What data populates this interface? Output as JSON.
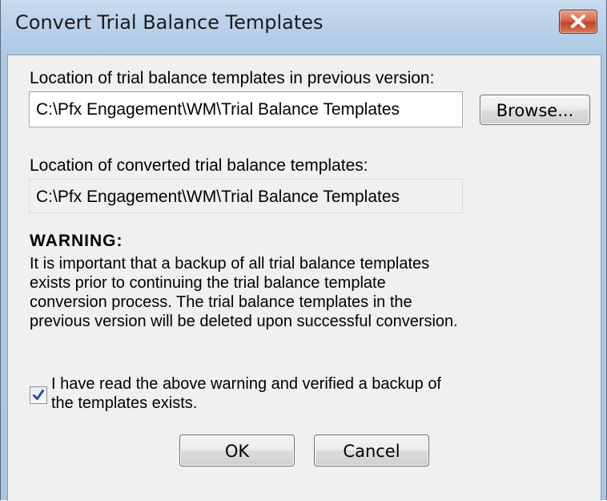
{
  "window": {
    "title": "Convert Trial Balance Templates"
  },
  "source": {
    "label": "Location of trial balance templates in previous version:",
    "value": "C:\\Pfx Engagement\\WM\\Trial Balance Templates",
    "browse_label": "Browse..."
  },
  "destination": {
    "label": "Location of converted trial balance templates:",
    "value": "C:\\Pfx Engagement\\WM\\Trial Balance Templates"
  },
  "warning": {
    "heading": "WARNING:",
    "text": "It is important that a backup of all trial balance templates exists prior to continuing the trial balance template conversion process. The trial balance templates in the previous version will be deleted upon successful conversion."
  },
  "confirm": {
    "checked": true,
    "label": "I have read the above warning and verified a backup of the templates exists."
  },
  "buttons": {
    "ok": "OK",
    "cancel": "Cancel"
  },
  "icons": {
    "close": "close-icon",
    "check": "checkmark-icon"
  },
  "colors": {
    "titlebar": "#b7cfe8",
    "close_button": "#c94a2e",
    "client_background": "#f0f0f0",
    "checkmark": "#2a4f9e"
  }
}
